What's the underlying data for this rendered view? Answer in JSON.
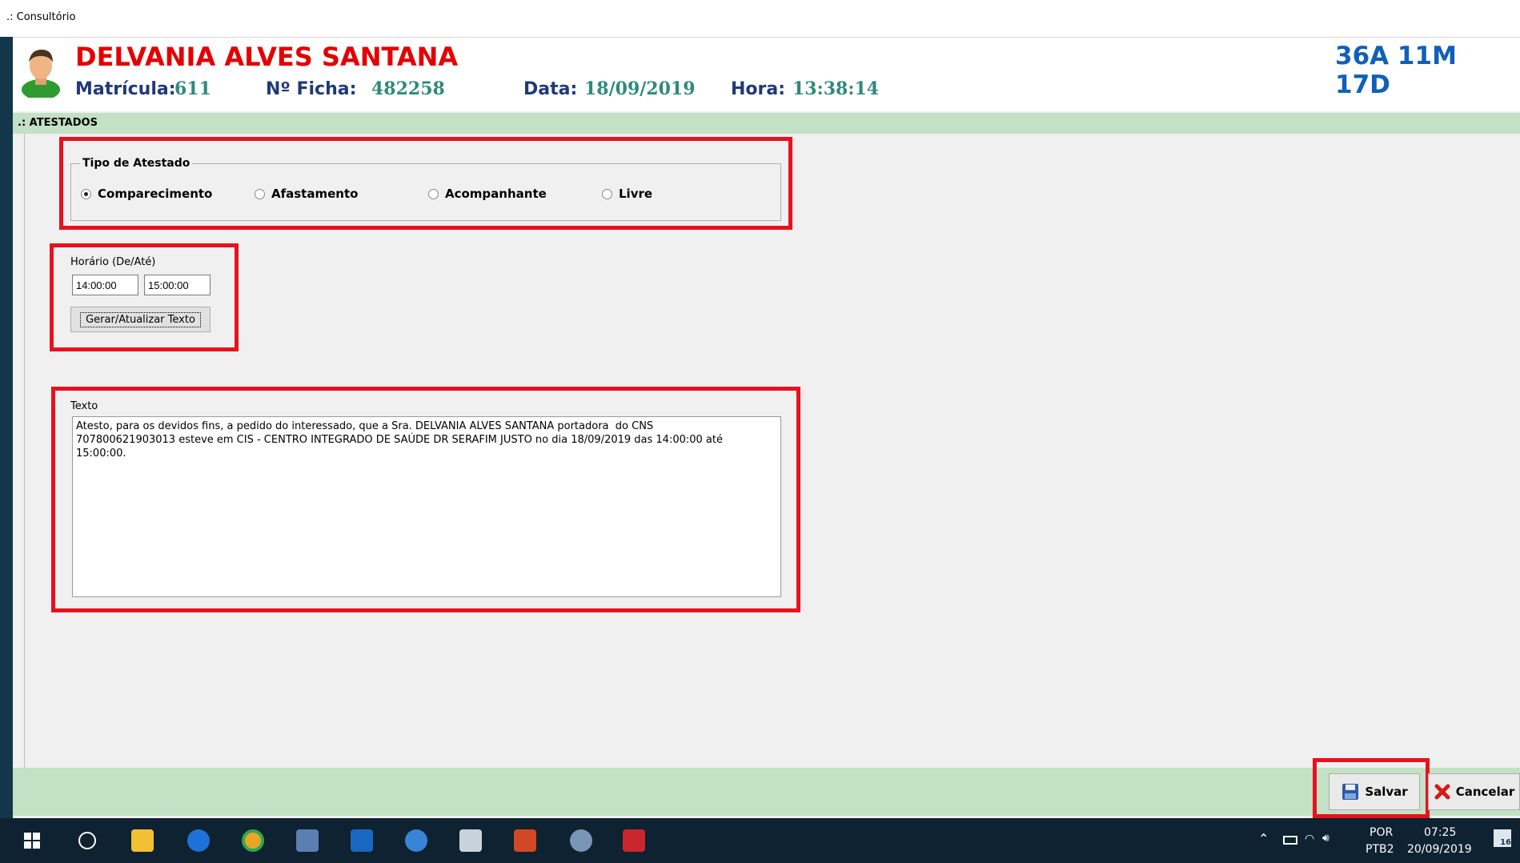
{
  "window": {
    "title": ".: Consultório"
  },
  "patient": {
    "name": "DELVANIA ALVES SANTANA",
    "age": "36A 11M 17D",
    "matricula_label": "Matrícula:",
    "matricula_value": "611",
    "ficha_label": "Nº Ficha:",
    "ficha_value": "482258",
    "data_label": "Data:",
    "data_value": "18/09/2019",
    "hora_label": "Hora:",
    "hora_value": "13:38:14"
  },
  "section": {
    "title": ".: ATESTADOS"
  },
  "tipo_atestado": {
    "legend": "Tipo de Atestado",
    "options": [
      {
        "label": "Comparecimento",
        "checked": true
      },
      {
        "label": "Afastamento",
        "checked": false
      },
      {
        "label": "Acompanhante",
        "checked": false
      },
      {
        "label": "Livre",
        "checked": false
      }
    ]
  },
  "horario": {
    "label": "Horário (De/Até)",
    "de": "14:00:00",
    "ate": "15:00:00",
    "button": "Gerar/Atualizar Texto"
  },
  "texto": {
    "label": "Texto",
    "content": "Atesto, para os devidos fins, a pedido do interessado, que a Sra. DELVANIA ALVES SANTANA portadora  do CNS\n707800621903013 esteve em CIS - CENTRO INTEGRADO DE SAÚDE DR SERAFIM JUSTO no dia 18/09/2019 das 14:00:00 até\n15:00:00."
  },
  "actions": {
    "save": "Salvar",
    "cancel": "Cancelar"
  },
  "tray": {
    "lang1": "POR",
    "lang2": "PTB2",
    "time": "07:25",
    "date": "20/09/2019",
    "notif_count": "16"
  },
  "colors": {
    "patient_name": "#e50000",
    "age": "#1060b8",
    "label": "#1e3a78",
    "value": "#2e8a7c",
    "section_bar": "#c3e1c4",
    "highlight": "#e8111e"
  }
}
